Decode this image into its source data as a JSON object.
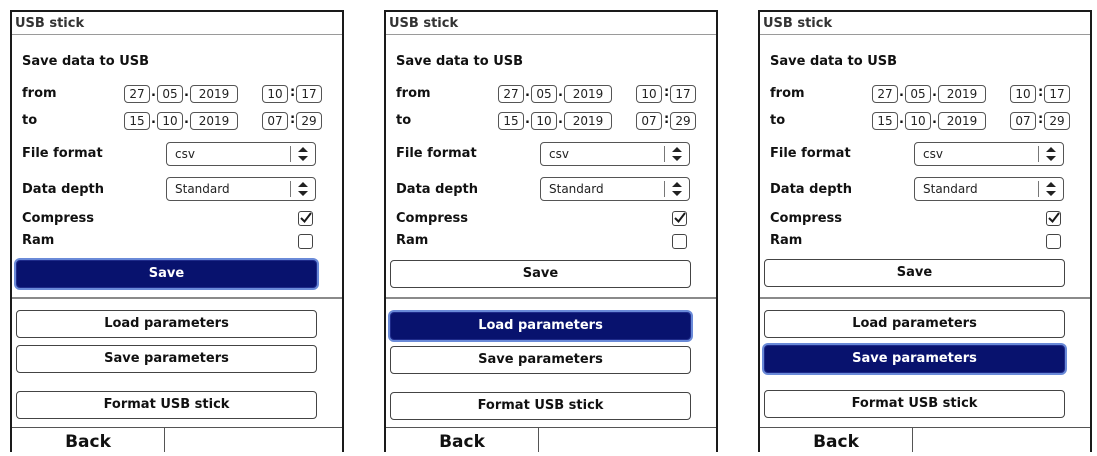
{
  "panels": [
    {
      "title": "USB stick",
      "heading": "Save data to USB",
      "from_label": "from",
      "to_label": "to",
      "from": {
        "day": "27",
        "month": "05",
        "year": "2019",
        "hour": "10",
        "minute": "17"
      },
      "to": {
        "day": "15",
        "month": "10",
        "year": "2019",
        "hour": "07",
        "minute": "29"
      },
      "file_format_label": "File format",
      "file_format_value": "csv",
      "data_depth_label": "Data depth",
      "data_depth_value": "Standard",
      "compress_label": "Compress",
      "compress_checked": true,
      "ram_label": "Ram",
      "ram_checked": false,
      "save_label": "Save",
      "load_params_label": "Load parameters",
      "save_params_label": "Save parameters",
      "format_label": "Format USB stick",
      "back_label": "Back",
      "focused": "save"
    },
    {
      "title": "USB stick",
      "heading": "Save data to USB",
      "from_label": "from",
      "to_label": "to",
      "from": {
        "day": "27",
        "month": "05",
        "year": "2019",
        "hour": "10",
        "minute": "17"
      },
      "to": {
        "day": "15",
        "month": "10",
        "year": "2019",
        "hour": "07",
        "minute": "29"
      },
      "file_format_label": "File format",
      "file_format_value": "csv",
      "data_depth_label": "Data depth",
      "data_depth_value": "Standard",
      "compress_label": "Compress",
      "compress_checked": true,
      "ram_label": "Ram",
      "ram_checked": false,
      "save_label": "Save",
      "load_params_label": "Load parameters",
      "save_params_label": "Save parameters",
      "format_label": "Format USB stick",
      "back_label": "Back",
      "focused": "load"
    },
    {
      "title": "USB stick",
      "heading": "Save data to USB",
      "from_label": "from",
      "to_label": "to",
      "from": {
        "day": "27",
        "month": "05",
        "year": "2019",
        "hour": "10",
        "minute": "17"
      },
      "to": {
        "day": "15",
        "month": "10",
        "year": "2019",
        "hour": "07",
        "minute": "29"
      },
      "file_format_label": "File format",
      "file_format_value": "csv",
      "data_depth_label": "Data depth",
      "data_depth_value": "Standard",
      "compress_label": "Compress",
      "compress_checked": true,
      "ram_label": "Ram",
      "ram_checked": false,
      "save_label": "Save",
      "load_params_label": "Load parameters",
      "save_params_label": "Save parameters",
      "format_label": "Format USB stick",
      "back_label": "Back",
      "focused": "saveparams"
    }
  ],
  "colors": {
    "active_button": "#08126e",
    "active_text": "#ffffff",
    "focus_ring": "#6a8ad8"
  },
  "icons": {
    "select_arrows": "up-down-arrows-icon",
    "checkbox_checked": "checkmark-icon"
  }
}
